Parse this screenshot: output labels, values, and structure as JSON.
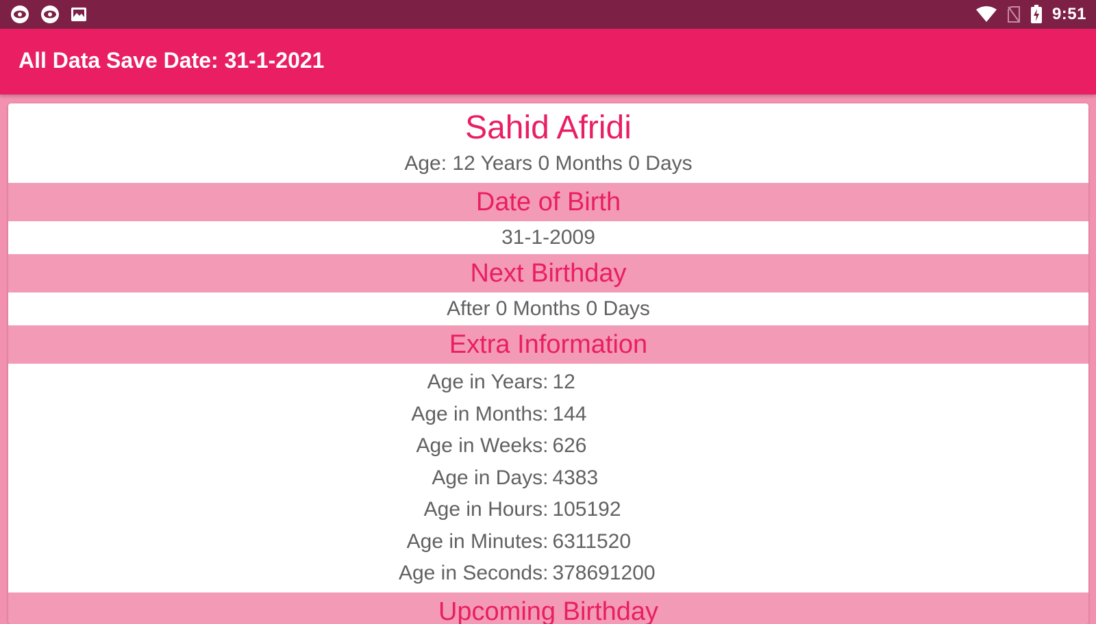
{
  "status_bar": {
    "time": "9:51",
    "left_icons": [
      "eye-notification-icon",
      "eye-notification-icon",
      "image-notification-icon"
    ],
    "right_icons": [
      "wifi-icon",
      "no-sim-icon",
      "battery-charging-icon"
    ]
  },
  "app_bar": {
    "title": "All Data Save Date: 31-1-2021"
  },
  "profile": {
    "name": "Sahid Afridi",
    "age_summary": "Age: 12 Years 0 Months 0 Days"
  },
  "sections": {
    "dob_header": "Date of Birth",
    "dob_value": "31-1-2009",
    "next_birthday_header": "Next Birthday",
    "next_birthday_value": "After 0 Months 0 Days",
    "extra_header": "Extra Information",
    "upcoming_header": "Upcoming Birthday"
  },
  "extra_info": [
    {
      "label": "Age in Years:",
      "value": "12"
    },
    {
      "label": "Age in Months:",
      "value": "144"
    },
    {
      "label": "Age in Weeks:",
      "value": "626"
    },
    {
      "label": "Age in Days:",
      "value": "4383"
    },
    {
      "label": "Age in Hours:",
      "value": "105192"
    },
    {
      "label": "Age in Minutes:",
      "value": "6311520"
    },
    {
      "label": "Age in Seconds:",
      "value": "378691200"
    }
  ],
  "colors": {
    "status_bar": "#7d2046",
    "app_bar": "#e91e63",
    "section_header_bg": "#f39ab7",
    "accent_text": "#e91e63",
    "body_text": "#616161"
  }
}
